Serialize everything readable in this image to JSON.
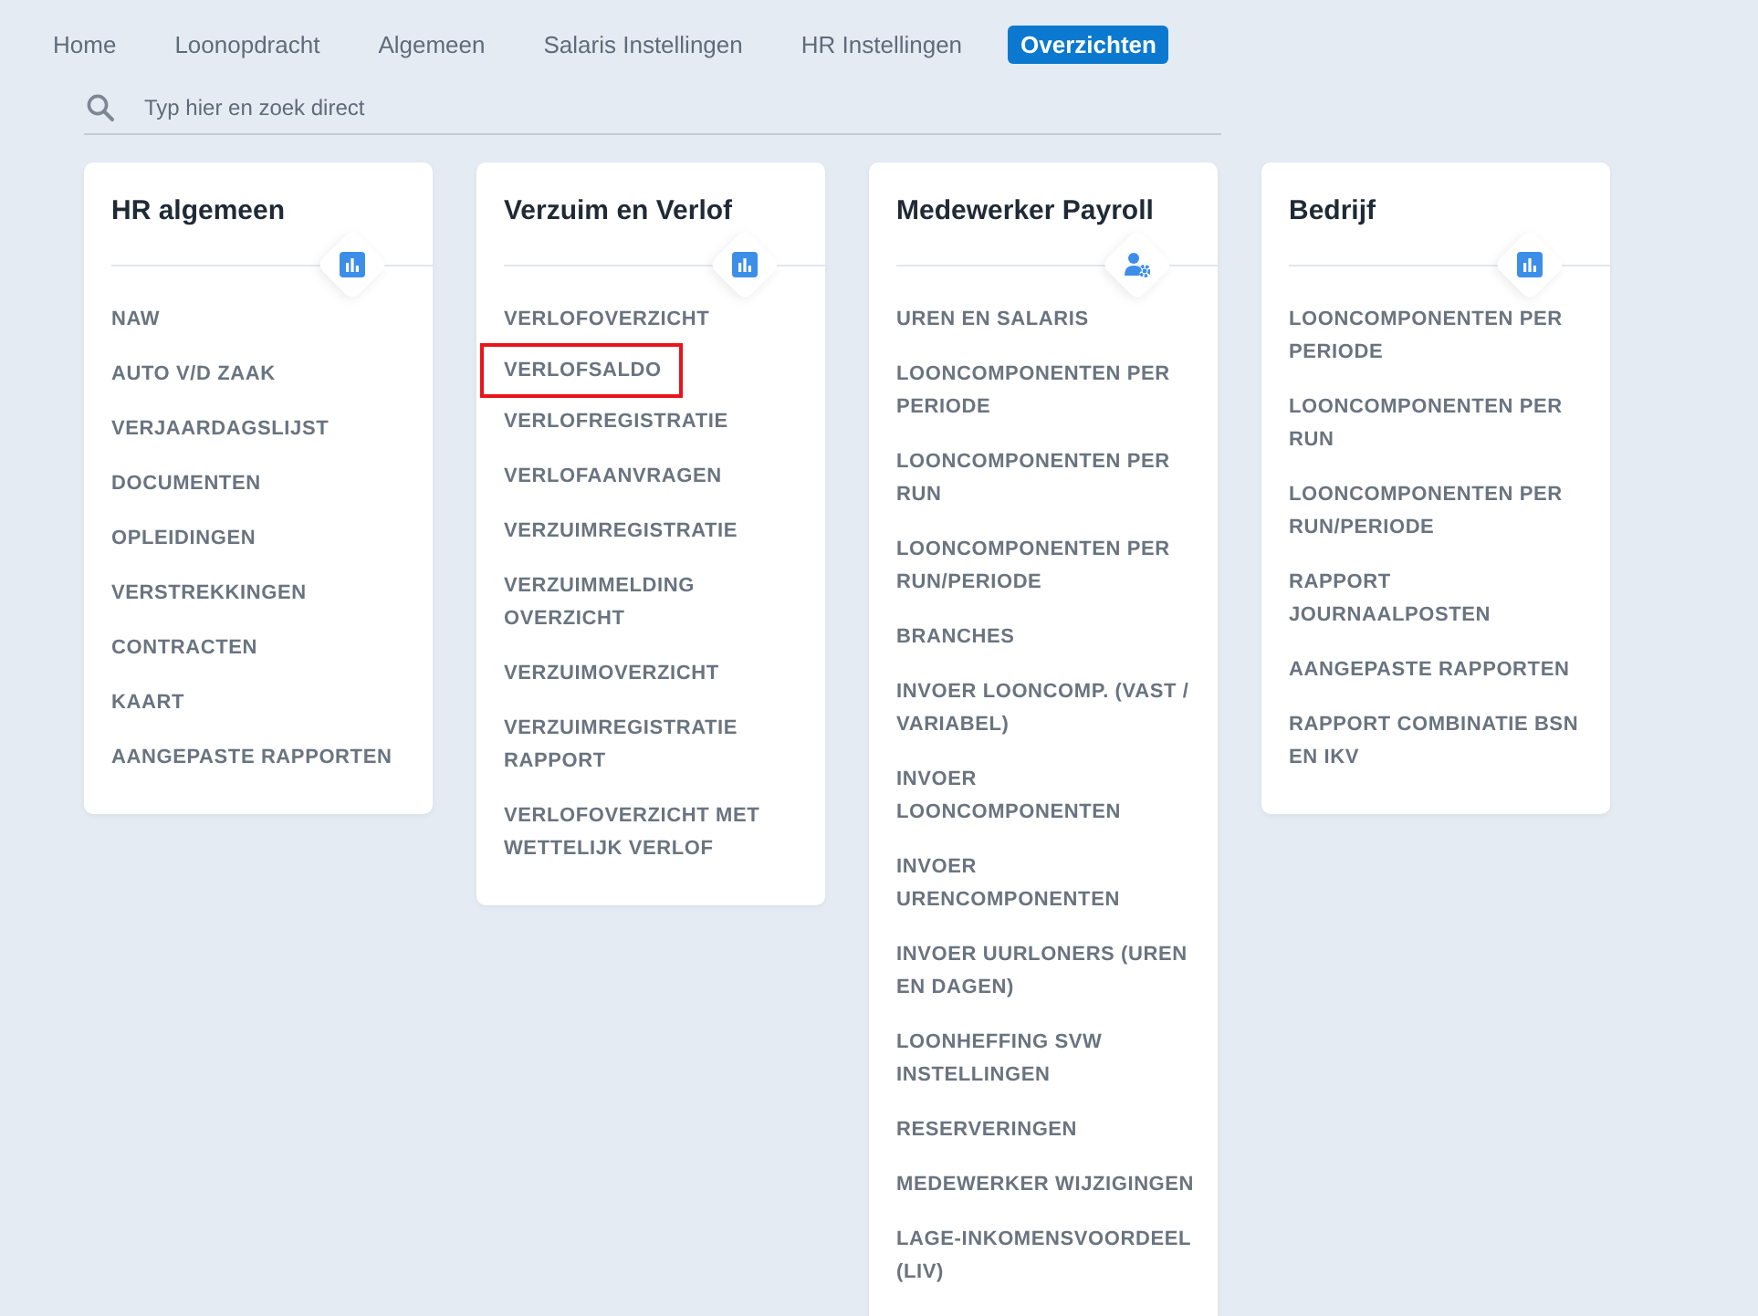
{
  "tabs": [
    {
      "label": "Home",
      "selected": false
    },
    {
      "label": "Loonopdracht",
      "selected": false
    },
    {
      "label": "Algemeen",
      "selected": false
    },
    {
      "label": "Salaris Instellingen",
      "selected": false
    },
    {
      "label": "HR Instellingen",
      "selected": false
    },
    {
      "label": "Overzichten",
      "selected": true
    }
  ],
  "search": {
    "placeholder": "Typ hier en zoek direct"
  },
  "cards": [
    {
      "title": "HR algemeen",
      "kind": "chart",
      "items": [
        {
          "label": "NAW",
          "highlighted": false
        },
        {
          "label": "AUTO V/D ZAAK",
          "highlighted": false
        },
        {
          "label": "VERJAARDAGSLIJST",
          "highlighted": false
        },
        {
          "label": "DOCUMENTEN",
          "highlighted": false
        },
        {
          "label": "OPLEIDINGEN",
          "highlighted": false
        },
        {
          "label": "VERSTREKKINGEN",
          "highlighted": false
        },
        {
          "label": "CONTRACTEN",
          "highlighted": false
        },
        {
          "label": "KAART",
          "highlighted": false
        },
        {
          "label": "AANGEPASTE RAPPORTEN",
          "highlighted": false
        }
      ]
    },
    {
      "title": "Verzuim en Verlof",
      "kind": "chart",
      "items": [
        {
          "label": "VERLOFOVERZICHT",
          "highlighted": false
        },
        {
          "label": "VERLOFSALDO",
          "highlighted": true
        },
        {
          "label": "VERLOFREGISTRATIE",
          "highlighted": false
        },
        {
          "label": "VERLOFAANVRAGEN",
          "highlighted": false
        },
        {
          "label": "VERZUIMREGISTRATIE",
          "highlighted": false
        },
        {
          "label": "VERZUIMMELDING OVERZICHT",
          "highlighted": false
        },
        {
          "label": "VERZUIMOVERZICHT",
          "highlighted": false
        },
        {
          "label": "VERZUIMREGISTRATIE RAPPORT",
          "highlighted": false
        },
        {
          "label": "VERLOFOVERZICHT MET WETTELIJK VERLOF",
          "highlighted": false
        }
      ]
    },
    {
      "title": "Medewerker Payroll",
      "kind": "user-gear",
      "items": [
        {
          "label": "UREN EN SALARIS",
          "highlighted": false
        },
        {
          "label": "LOONCOMPONENTEN PER PERIODE",
          "highlighted": false
        },
        {
          "label": "LOONCOMPONENTEN PER RUN",
          "highlighted": false
        },
        {
          "label": "LOONCOMPONENTEN PER RUN/PERIODE",
          "highlighted": false
        },
        {
          "label": "BRANCHES",
          "highlighted": false
        },
        {
          "label": "INVOER LOONCOMP. (VAST / VARIABEL)",
          "highlighted": false
        },
        {
          "label": "INVOER LOONCOMPONENTEN",
          "highlighted": false
        },
        {
          "label": "INVOER URENCOMPONENTEN",
          "highlighted": false
        },
        {
          "label": "INVOER UURLONERS (UREN EN DAGEN)",
          "highlighted": false
        },
        {
          "label": "LOONHEFFING SVW INSTELLINGEN",
          "highlighted": false
        },
        {
          "label": "RESERVERINGEN",
          "highlighted": false
        },
        {
          "label": "MEDEWERKER WIJZIGINGEN",
          "highlighted": false
        },
        {
          "label": "LAGE-INKOMENSVOORDEEL (LIV)",
          "highlighted": false
        }
      ]
    },
    {
      "title": "Bedrijf",
      "kind": "chart",
      "items": [
        {
          "label": "LOONCOMPONENTEN PER PERIODE",
          "highlighted": false
        },
        {
          "label": "LOONCOMPONENTEN PER RUN",
          "highlighted": false
        },
        {
          "label": "LOONCOMPONENTEN PER RUN/PERIODE",
          "highlighted": false
        },
        {
          "label": "RAPPORT JOURNAALPOSTEN",
          "highlighted": false
        },
        {
          "label": "AANGEPASTE RAPPORTEN",
          "highlighted": false
        },
        {
          "label": "RAPPORT COMBINATIE BSN EN IKV",
          "highlighted": false
        }
      ]
    }
  ]
}
